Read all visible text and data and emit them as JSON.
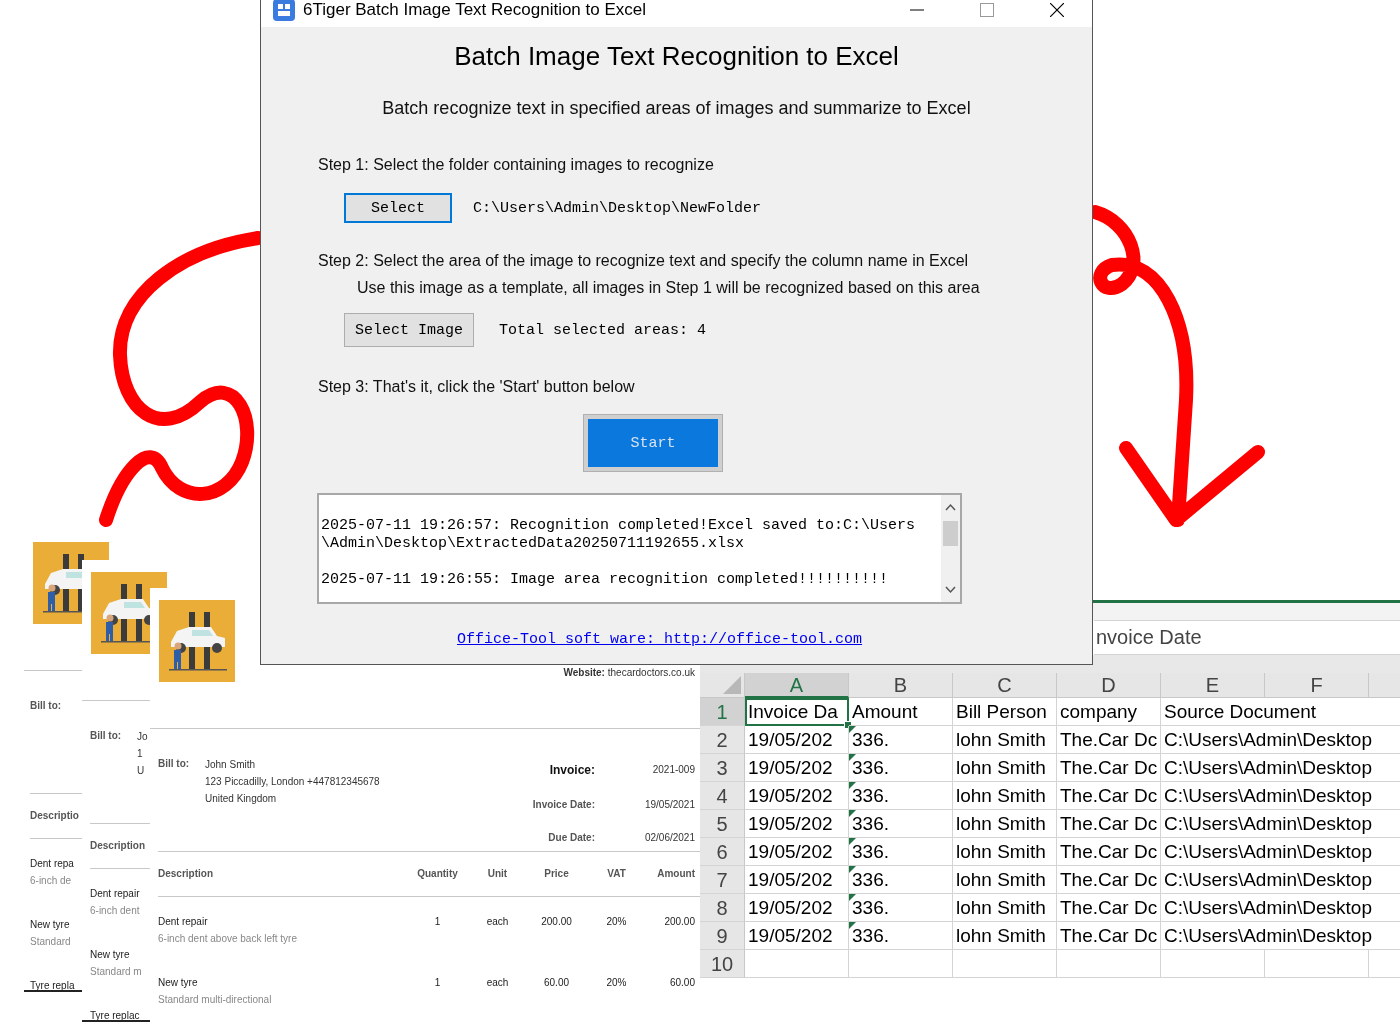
{
  "app_window": {
    "title": "6Tiger Batch Image Text Recognition to Excel",
    "heading": "Batch Image Text Recognition to Excel",
    "subtitle": "Batch recognize text in specified areas of images and summarize to Excel",
    "step1": {
      "label": "Step 1: Select the folder containing images to recognize",
      "button": {
        "label": "Select",
        "focused": true
      },
      "path": "C:\\Users\\Admin\\Desktop\\NewFolder"
    },
    "step2": {
      "label": "Step 2: Select the area of the image to recognize text and specify the column name in Excel",
      "hint": "Use this image as a template, all images in Step 1 will be recognized based on this area",
      "button": {
        "label": "Select Image",
        "focused": false
      },
      "status": "Total selected areas: 4"
    },
    "step3": {
      "label": "Step 3: That's it, click the 'Start' button below",
      "button": {
        "label": "Start",
        "primary": true
      }
    },
    "log": [
      "2025-07-11 19:26:57: Recognition completed!Excel saved to:C:\\Users\\Admin\\Desktop\\ExtractedData20250711192655.xlsx",
      "2025-07-11 19:26:55: Image area recognition completed!!!!!!!!!!"
    ],
    "link": "Office-Tool soft ware: http://office-tool.com"
  },
  "invoice_pages": [
    {
      "bill_to_label": "Bill to:",
      "description_header": "Descriptio",
      "items": [
        {
          "name": "Dent repa",
          "detail": "6-inch de"
        },
        {
          "name": "New tyre",
          "detail": "Standard"
        },
        {
          "name": "Tyre repla"
        }
      ]
    },
    {
      "bill_to_label": "Bill to:",
      "bill_to_lines": [
        "Jo",
        "1",
        "U"
      ],
      "description_header": "Description",
      "items": [
        {
          "name": "Dent repair",
          "detail": "6-inch dent"
        },
        {
          "name": "New tyre",
          "detail": "Standard m"
        },
        {
          "name": "Tyre replac"
        }
      ]
    },
    {
      "website_label": "Website:",
      "website": "thecardoctors.co.uk",
      "bill_to_label": "Bill to:",
      "bill_to_lines": [
        "John Smith",
        "123 Piccadilly, London +447812345678",
        "United Kingdom"
      ],
      "invoice_details": [
        {
          "label": "Invoice:",
          "value": "2021-009",
          "bold": true
        },
        {
          "label": "Invoice Date:",
          "value": "19/05/2021",
          "bold": false
        },
        {
          "label": "Due Date:",
          "value": "02/06/2021",
          "bold": false
        }
      ],
      "columns": [
        "Description",
        "Quantity",
        "Unit",
        "Price",
        "VAT",
        "Amount"
      ],
      "items": [
        {
          "name": "Dent repair",
          "detail": "6-inch dent above back left tyre",
          "values": [
            "1",
            "each",
            "200.00",
            "20%",
            "200.00"
          ]
        },
        {
          "name": "New tyre",
          "detail": "Standard multi-directional",
          "values": [
            "1",
            "each",
            "60.00",
            "20%",
            "60.00"
          ]
        }
      ]
    }
  ],
  "spreadsheet": {
    "formula_bar": "nvoice Date",
    "columns": [
      {
        "label": "A",
        "selected": true
      },
      {
        "label": "B",
        "selected": false
      },
      {
        "label": "C",
        "selected": false
      },
      {
        "label": "D",
        "selected": false
      },
      {
        "label": "E",
        "selected": false
      },
      {
        "label": "F",
        "selected": false
      }
    ],
    "rows": [
      {
        "number": "1",
        "selected": true,
        "flagged": false,
        "cells": [
          "Invoice Da",
          "Amount",
          "Bill Person",
          "company",
          "Source Document"
        ]
      },
      {
        "number": "2",
        "selected": false,
        "flagged": true,
        "cells": [
          "19/05/202",
          "336.",
          "lohn Smith",
          "The.Car Dc",
          "C:\\Users\\Admin\\Desktop"
        ]
      },
      {
        "number": "3",
        "selected": false,
        "flagged": true,
        "cells": [
          "19/05/202",
          "336.",
          "lohn Smith",
          "The.Car Dc",
          "C:\\Users\\Admin\\Desktop"
        ]
      },
      {
        "number": "4",
        "selected": false,
        "flagged": true,
        "cells": [
          "19/05/202",
          "336.",
          "lohn Smith",
          "The.Car Dc",
          "C:\\Users\\Admin\\Desktop"
        ]
      },
      {
        "number": "5",
        "selected": false,
        "flagged": true,
        "cells": [
          "19/05/202",
          "336.",
          "lohn Smith",
          "The.Car Dc",
          "C:\\Users\\Admin\\Desktop"
        ]
      },
      {
        "number": "6",
        "selected": false,
        "flagged": true,
        "cells": [
          "19/05/202",
          "336.",
          "lohn Smith",
          "The.Car Dc",
          "C:\\Users\\Admin\\Desktop"
        ]
      },
      {
        "number": "7",
        "selected": false,
        "flagged": true,
        "cells": [
          "19/05/202",
          "336.",
          "lohn Smith",
          "The.Car Dc",
          "C:\\Users\\Admin\\Desktop"
        ]
      },
      {
        "number": "8",
        "selected": false,
        "flagged": true,
        "cells": [
          "19/05/202",
          "336.",
          "lohn Smith",
          "The.Car Dc",
          "C:\\Users\\Admin\\Desktop"
        ]
      },
      {
        "number": "9",
        "selected": false,
        "flagged": true,
        "cells": [
          "19/05/202",
          "336.",
          "lohn Smith",
          "The.Car Dc",
          "C:\\Users\\Admin\\Desktop"
        ]
      },
      {
        "number": "10",
        "selected": false,
        "flagged": false
      }
    ]
  }
}
